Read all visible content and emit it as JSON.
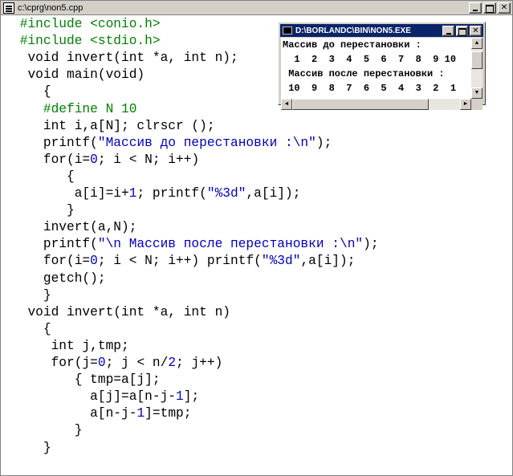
{
  "editor": {
    "title": "c:\\cprg\\non5.cpp",
    "lines": [
      {
        "indent": " ",
        "parts": [
          {
            "t": "#include <conio.h>",
            "c": "pp"
          }
        ]
      },
      {
        "indent": " ",
        "parts": [
          {
            "t": "#include <stdio.h>",
            "c": "pp"
          }
        ]
      },
      {
        "indent": "  ",
        "parts": [
          {
            "t": "void invert(int *a, int n);",
            "c": ""
          }
        ]
      },
      {
        "indent": "  ",
        "parts": [
          {
            "t": "void main(void)",
            "c": ""
          }
        ]
      },
      {
        "indent": "    ",
        "parts": [
          {
            "t": "{",
            "c": ""
          }
        ]
      },
      {
        "indent": "    ",
        "parts": [
          {
            "t": "#define N 10",
            "c": "pp"
          }
        ]
      },
      {
        "indent": "    ",
        "parts": [
          {
            "t": "int i,a[N]; clrscr ();",
            "c": ""
          }
        ]
      },
      {
        "indent": "    ",
        "parts": [
          {
            "t": "printf(",
            "c": ""
          },
          {
            "t": "\"Массив до перестановки :\\n\"",
            "c": "str"
          },
          {
            "t": ");",
            "c": ""
          }
        ]
      },
      {
        "indent": "    ",
        "parts": [
          {
            "t": "for(i=",
            "c": ""
          },
          {
            "t": "0",
            "c": "num"
          },
          {
            "t": "; i < N; i++)",
            "c": ""
          }
        ]
      },
      {
        "indent": "       ",
        "parts": [
          {
            "t": "{",
            "c": ""
          }
        ]
      },
      {
        "indent": "        ",
        "parts": [
          {
            "t": "a[i]=i+",
            "c": ""
          },
          {
            "t": "1",
            "c": "num"
          },
          {
            "t": "; printf(",
            "c": ""
          },
          {
            "t": "\"%3d\"",
            "c": "str"
          },
          {
            "t": ",a[i]);",
            "c": ""
          }
        ]
      },
      {
        "indent": "       ",
        "parts": [
          {
            "t": "}",
            "c": ""
          }
        ]
      },
      {
        "indent": "    ",
        "parts": [
          {
            "t": "invert(a,N);",
            "c": ""
          }
        ]
      },
      {
        "indent": "    ",
        "parts": [
          {
            "t": "printf(",
            "c": ""
          },
          {
            "t": "\"\\n Массив после перестановки :\\n\"",
            "c": "str"
          },
          {
            "t": ");",
            "c": ""
          }
        ]
      },
      {
        "indent": "    ",
        "parts": [
          {
            "t": "for(i=",
            "c": ""
          },
          {
            "t": "0",
            "c": "num"
          },
          {
            "t": "; i < N; i++) printf(",
            "c": ""
          },
          {
            "t": "\"%3d\"",
            "c": "str"
          },
          {
            "t": ",a[i]);",
            "c": ""
          }
        ]
      },
      {
        "indent": "    ",
        "parts": [
          {
            "t": "getch();",
            "c": ""
          }
        ]
      },
      {
        "indent": "    ",
        "parts": [
          {
            "t": "}",
            "c": ""
          }
        ]
      },
      {
        "indent": "  ",
        "parts": [
          {
            "t": "void invert(int *a, int n)",
            "c": ""
          }
        ]
      },
      {
        "indent": "    ",
        "parts": [
          {
            "t": "{",
            "c": ""
          }
        ]
      },
      {
        "indent": "     ",
        "parts": [
          {
            "t": "int j,tmp;",
            "c": ""
          }
        ]
      },
      {
        "indent": "     ",
        "parts": [
          {
            "t": "for(j=",
            "c": ""
          },
          {
            "t": "0",
            "c": "num"
          },
          {
            "t": "; j < n/",
            "c": ""
          },
          {
            "t": "2",
            "c": "num"
          },
          {
            "t": "; j++)",
            "c": ""
          }
        ]
      },
      {
        "indent": "        ",
        "parts": [
          {
            "t": "{ tmp=a[j];",
            "c": ""
          }
        ]
      },
      {
        "indent": "          ",
        "parts": [
          {
            "t": "a[j]=a[n-j-",
            "c": ""
          },
          {
            "t": "1",
            "c": "num"
          },
          {
            "t": "];",
            "c": ""
          }
        ]
      },
      {
        "indent": "          ",
        "parts": [
          {
            "t": "a[n-j-",
            "c": ""
          },
          {
            "t": "1",
            "c": "num"
          },
          {
            "t": "]=tmp;",
            "c": ""
          }
        ]
      },
      {
        "indent": "        ",
        "parts": [
          {
            "t": "}",
            "c": ""
          }
        ]
      },
      {
        "indent": "    ",
        "parts": [
          {
            "t": "}",
            "c": ""
          }
        ]
      }
    ]
  },
  "console": {
    "title": "D:\\BORLANDC\\BIN\\NON5.EXE",
    "lines": [
      "Массив до перестановки :",
      "  1  2  3  4  5  6  7  8  9 10",
      " Массив после перестановки :",
      " 10  9  8  7  6  5  4  3  2  1"
    ]
  },
  "icons": {
    "window_minimize": "minimize-icon",
    "window_maximize": "maximize-icon",
    "window_close": "close-icon",
    "scroll_up": "▲",
    "scroll_down": "▼",
    "scroll_left": "◄",
    "scroll_right": "►",
    "close_glyph": "✕"
  },
  "colors": {
    "preprocessor": "#008000",
    "string_literal": "#0000c0",
    "console_titlebar": "#0a246a"
  }
}
